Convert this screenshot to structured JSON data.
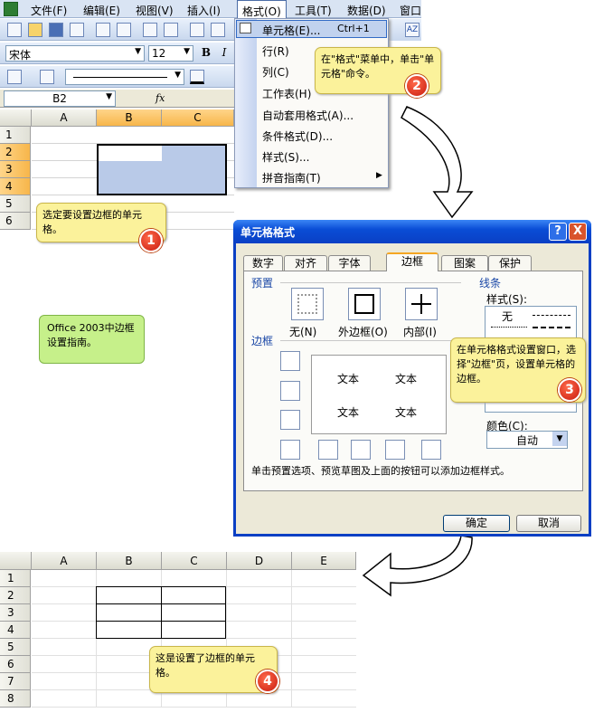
{
  "menubar": {
    "items": [
      "文件(F)",
      "编辑(E)",
      "视图(V)",
      "插入(I)",
      "格式(O)",
      "工具(T)",
      "数据(D)",
      "窗口"
    ]
  },
  "toolbar": {
    "font": "宋体",
    "size": "12",
    "bold": "B",
    "italic": "I",
    "fx": "fx"
  },
  "namebox": "B2",
  "sheet_top": {
    "columns": [
      "A",
      "B",
      "C"
    ],
    "rows": [
      "1",
      "2",
      "3",
      "4",
      "5",
      "6"
    ]
  },
  "format_menu": {
    "items": [
      {
        "label": "单元格(E)...",
        "shortcut": "Ctrl+1"
      },
      {
        "label": "行(R)",
        "shortcut": ""
      },
      {
        "label": "列(C)",
        "shortcut": ""
      },
      {
        "label": "工作表(H)",
        "shortcut": ""
      },
      {
        "label": "自动套用格式(A)...",
        "shortcut": ""
      },
      {
        "label": "条件格式(D)...",
        "shortcut": ""
      },
      {
        "label": "样式(S)...",
        "shortcut": ""
      },
      {
        "label": "拼音指南(T)",
        "shortcut": ""
      }
    ]
  },
  "callouts": {
    "c1": "选定要设置边框的单元格。",
    "c2": "在\"格式\"菜单中，单击\"单元格\"命令。",
    "c3": "在单元格格式设置窗口，选择\"边框\"页，设置单元格的边框。",
    "c4": "这是设置了边框的单元格。",
    "guide": "Office 2003中边框设置指南。"
  },
  "badges": [
    "1",
    "2",
    "3",
    "4"
  ],
  "dialog": {
    "title": "单元格格式",
    "tabs": [
      "数字",
      "对齐",
      "字体",
      "边框",
      "图案",
      "保护"
    ],
    "active_tab": "边框",
    "preset_label": "预置",
    "presets": [
      "无(N)",
      "外边框(O)",
      "内部(I)"
    ],
    "border_label": "边框",
    "preview_text": [
      "文本",
      "文本",
      "文本",
      "文本"
    ],
    "line_label": "线条",
    "style_label": "样式(S):",
    "style_none": "无",
    "color_label": "颜色(C):",
    "color_value": "自动",
    "hint": "单击预置选项、预览草图及上面的按钮可以添加边框样式。",
    "ok": "确定",
    "cancel": "取消",
    "help": "?",
    "close": "X"
  },
  "sheet_bottom": {
    "columns": [
      "A",
      "B",
      "C",
      "D",
      "E"
    ],
    "rows": [
      "1",
      "2",
      "3",
      "4",
      "5",
      "6",
      "7",
      "8"
    ]
  },
  "colors": {
    "selection": "#b9cae8",
    "callout": "#fbf29b",
    "badge": "#d0251a",
    "dialog_title": "#0a4dd6",
    "guide": "#c6f08a"
  }
}
